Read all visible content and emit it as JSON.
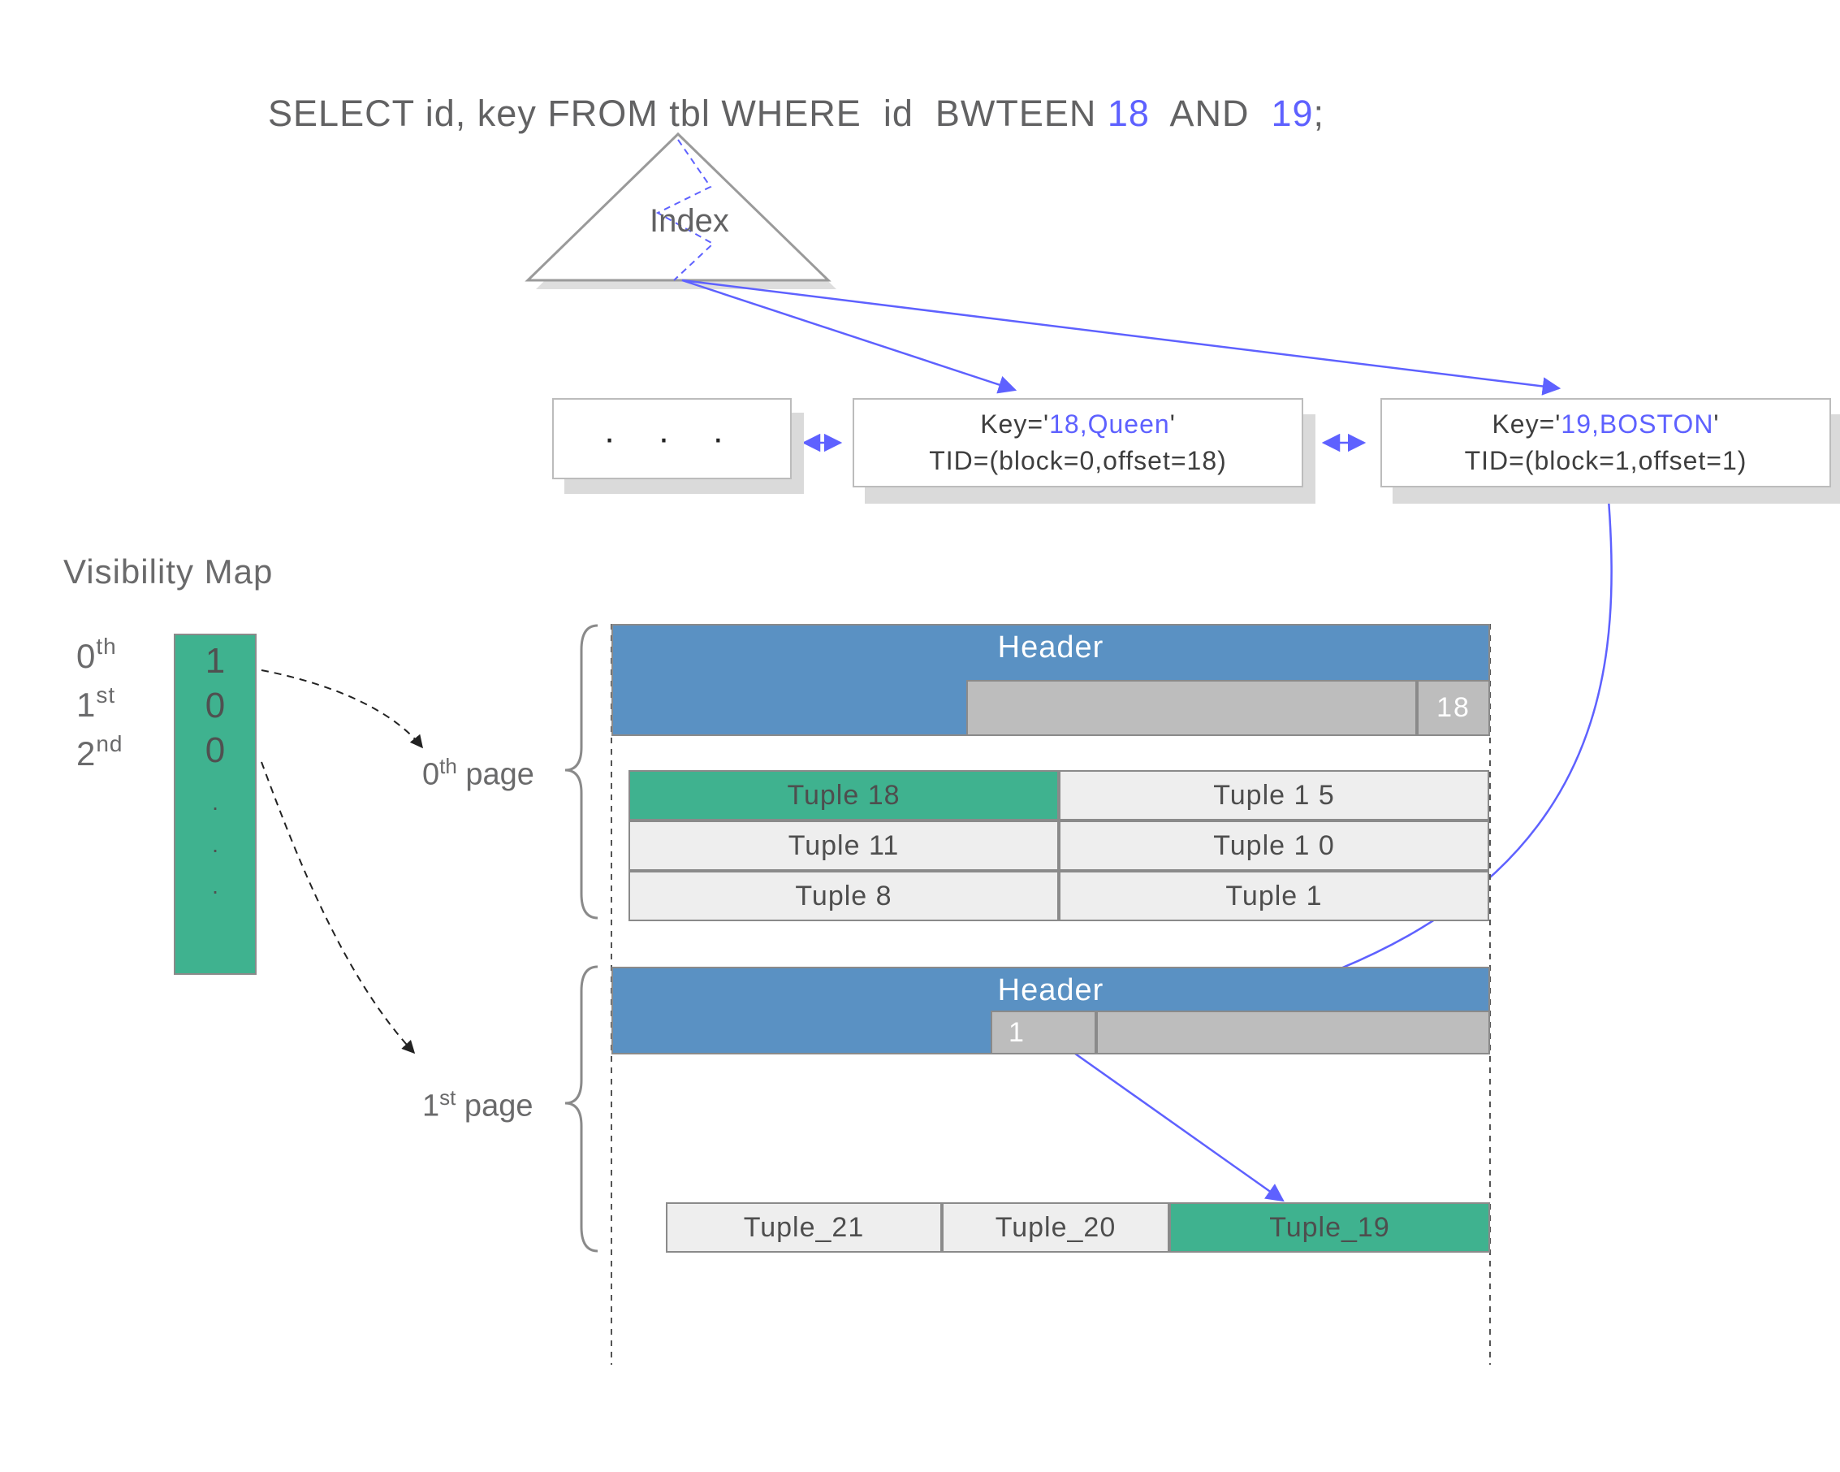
{
  "sql": {
    "prefix": "SELECT id, key FROM tbl WHERE  id  BWTEEN ",
    "literal1": "18",
    "mid": "  AND  ",
    "literal2": "19",
    "suffix": ";"
  },
  "index": {
    "label": "Index"
  },
  "leaves": {
    "dots": "·   ·   ·",
    "n1": {
      "key_prefix": "Key='",
      "key_val": "18,Queen",
      "key_suffix": "'",
      "tid": "TID=(block=0,offset=18)"
    },
    "n2": {
      "key_prefix": "Key='",
      "key_val": "19,BOSTON",
      "key_suffix": "'",
      "tid": "TID=(block=1,offset=1)"
    }
  },
  "vm": {
    "title": "Visibility Map",
    "ord0": "0",
    "ord0_sup": "th",
    "ord1": "1",
    "ord1_sup": "st",
    "ord2": "2",
    "ord2_sup": "nd",
    "bits": [
      "1",
      "0",
      "0"
    ],
    "dot": "·"
  },
  "pages": {
    "label0": "0",
    "label0_sup": "th",
    "label0_word": " page",
    "label1": "1",
    "label1_sup": "st",
    "label1_word": " page",
    "header_label": "Header",
    "p0": {
      "pointer_label": "18",
      "tuples": [
        "Tuple 18",
        "Tuple 1 5",
        "Tuple 11",
        "Tuple 1 0",
        "Tuple 8",
        "Tuple 1"
      ]
    },
    "p1": {
      "pointer_label": "1",
      "tuples": [
        "Tuple_21",
        "Tuple_20",
        "Tuple_19"
      ]
    }
  },
  "colors": {
    "blueHeader": "#5a91c3",
    "green": "#3fb28f",
    "grayFill": "#eeeeee",
    "grayPtr": "#bdbdbd",
    "arrowBlue": "#5e61ff"
  }
}
